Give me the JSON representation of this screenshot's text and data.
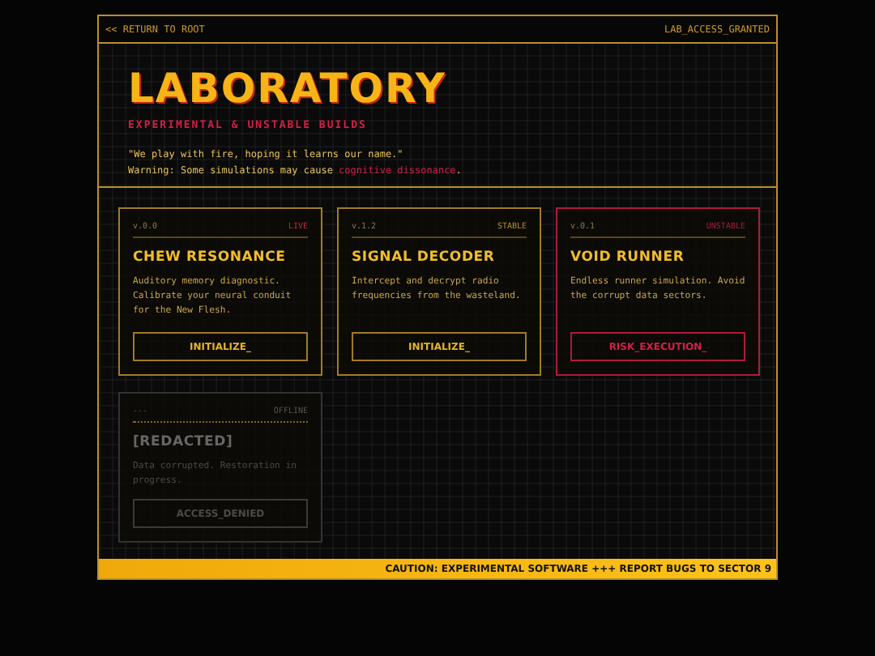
{
  "top_bar": {
    "back_link": "<< RETURN TO ROOT",
    "status": "LAB_ACCESS_GRANTED"
  },
  "header": {
    "title": "LABORATORY",
    "subtitle": "EXPERIMENTAL & UNSTABLE BUILDS",
    "quote": "\"We play with fire, hoping it learns our name.\"",
    "warning": "Warning: Some simulations may cause ",
    "warning_highlight": "cognitive dissonance",
    "warning_end": "."
  },
  "cards": [
    {
      "kind": "live",
      "version": "v.0.0",
      "status": "LIVE",
      "title": "CHEW RESONANCE",
      "description": "Auditory memory diagnostic. Calibrate your neural conduit for the New Flesh.",
      "action": "INITIALIZE_"
    },
    {
      "kind": "stable",
      "version": "v.1.2",
      "status": "STABLE",
      "title": "SIGNAL DECODER",
      "description": "Intercept and decrypt radio frequencies from the wasteland.",
      "action": "INITIALIZE_"
    },
    {
      "kind": "unstable",
      "version": "v.0.1",
      "status": "UNSTABLE",
      "title": "VOID RUNNER",
      "description": "Endless runner simulation. Avoid the corrupt data sectors.",
      "action": "RISK_EXECUTION_"
    },
    {
      "kind": "offline",
      "version": "---",
      "status": "OFFLINE",
      "title": "[REDACTED]",
      "description": "Data corrupted. Restoration in progress.",
      "action": "ACCESS_DENIED"
    }
  ],
  "footer": {
    "ticker": "CAUTION: EXPERIMENTAL SOFTWARE +++ REPORT BUGS TO SECTOR 9"
  }
}
